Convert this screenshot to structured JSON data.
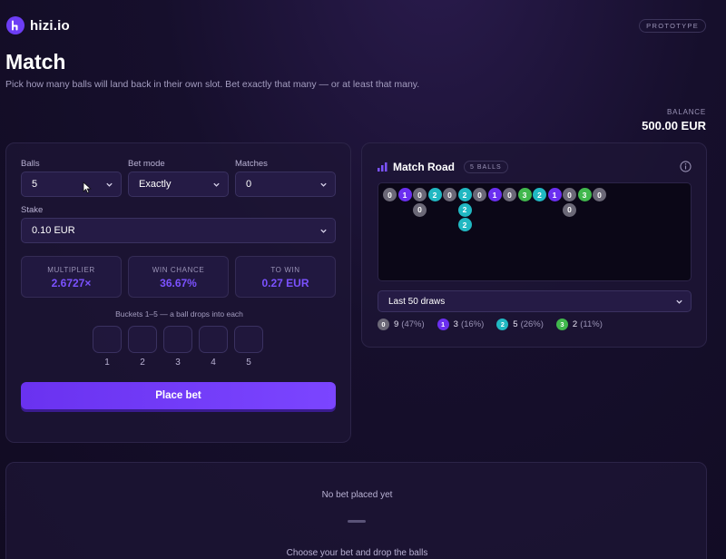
{
  "brand": {
    "name": "hizi.io",
    "badge": "PROTOTYPE"
  },
  "page": {
    "title": "Match",
    "subtitle": "Pick how many balls will land back in their own slot. Bet exactly that many — or at least that many."
  },
  "balance": {
    "label": "BALANCE",
    "value": "500.00 EUR"
  },
  "bet": {
    "balls_label": "Balls",
    "balls_value": "5",
    "mode_label": "Bet mode",
    "mode_value": "Exactly",
    "matches_label": "Matches",
    "matches_value": "0",
    "stake_label": "Stake",
    "stake_value": "0.10 EUR"
  },
  "stats": [
    {
      "label": "MULTIPLIER",
      "value": "2.6727×"
    },
    {
      "label": "WIN CHANCE",
      "value": "36.67%"
    },
    {
      "label": "TO WIN",
      "value": "0.27 EUR"
    }
  ],
  "buckets": {
    "caption": "Buckets 1–5 — a ball drops into each",
    "labels": [
      "1",
      "2",
      "3",
      "4",
      "5"
    ]
  },
  "place_bet_label": "Place bet",
  "road": {
    "title": "Match Road",
    "badge": "5 BALLS",
    "columns": [
      [
        0
      ],
      [
        1
      ],
      [
        0,
        0
      ],
      [
        2
      ],
      [
        0
      ],
      [
        2,
        2,
        2
      ],
      [
        0
      ],
      [
        1
      ],
      [
        0
      ],
      [
        3
      ],
      [
        2
      ],
      [
        1
      ],
      [
        0,
        0
      ],
      [
        3
      ],
      [
        0
      ]
    ],
    "range_value": "Last 50 draws",
    "legend": [
      {
        "ball": "0",
        "count": "9",
        "pct": "(47%)"
      },
      {
        "ball": "1",
        "count": "3",
        "pct": "(16%)"
      },
      {
        "ball": "2",
        "count": "5",
        "pct": "(26%)"
      },
      {
        "ball": "3",
        "count": "2",
        "pct": "(11%)"
      }
    ]
  },
  "result": {
    "empty_title": "No bet placed yet",
    "empty_hint": "Choose your bet and drop the balls"
  },
  "colors": {
    "accent": "#7b52ff",
    "ball_0": "#6b6877",
    "ball_1": "#6b2ff0",
    "ball_2": "#21b8c2",
    "ball_3": "#41b84d"
  }
}
